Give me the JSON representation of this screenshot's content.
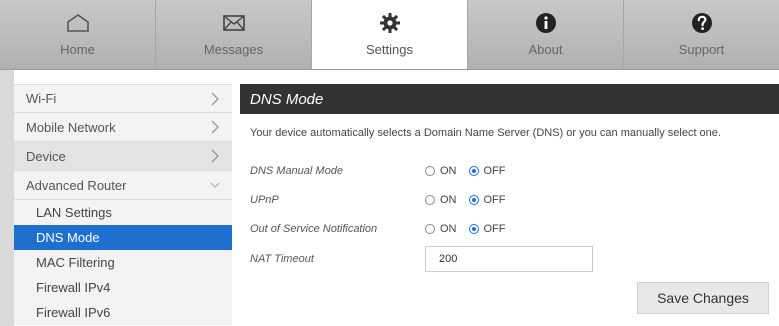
{
  "topnav": {
    "tabs": [
      {
        "label": "Home",
        "icon": "home-icon"
      },
      {
        "label": "Messages",
        "icon": "envelope-icon"
      },
      {
        "label": "Settings",
        "icon": "gear-icon",
        "active": true
      },
      {
        "label": "About",
        "icon": "info-icon"
      },
      {
        "label": "Support",
        "icon": "question-icon"
      }
    ]
  },
  "sidebar": {
    "items": [
      {
        "label": "Wi-Fi"
      },
      {
        "label": "Mobile Network"
      },
      {
        "label": "Device"
      },
      {
        "label": "Advanced Router"
      }
    ],
    "sub_items": [
      {
        "label": "LAN Settings"
      },
      {
        "label": "DNS Mode",
        "active": true
      },
      {
        "label": "MAC Filtering"
      },
      {
        "label": "Firewall IPv4"
      },
      {
        "label": "Firewall IPv6"
      }
    ]
  },
  "main": {
    "title": "DNS Mode",
    "description": "Your device automatically selects a Domain Name Server (DNS) or you can manually select one.",
    "settings": [
      {
        "label": "DNS Manual Mode",
        "on_label": "ON",
        "off_label": "OFF",
        "value": "OFF"
      },
      {
        "label": "UPnP",
        "on_label": "ON",
        "off_label": "OFF",
        "value": "OFF"
      },
      {
        "label": "Out of Service Notification",
        "on_label": "ON",
        "off_label": "OFF",
        "value": "OFF"
      }
    ],
    "nat_timeout": {
      "label": "NAT Timeout",
      "value": "200"
    },
    "save_label": "Save Changes"
  },
  "colors": {
    "accent": "#1f6fd1",
    "header_bg": "#333333"
  }
}
